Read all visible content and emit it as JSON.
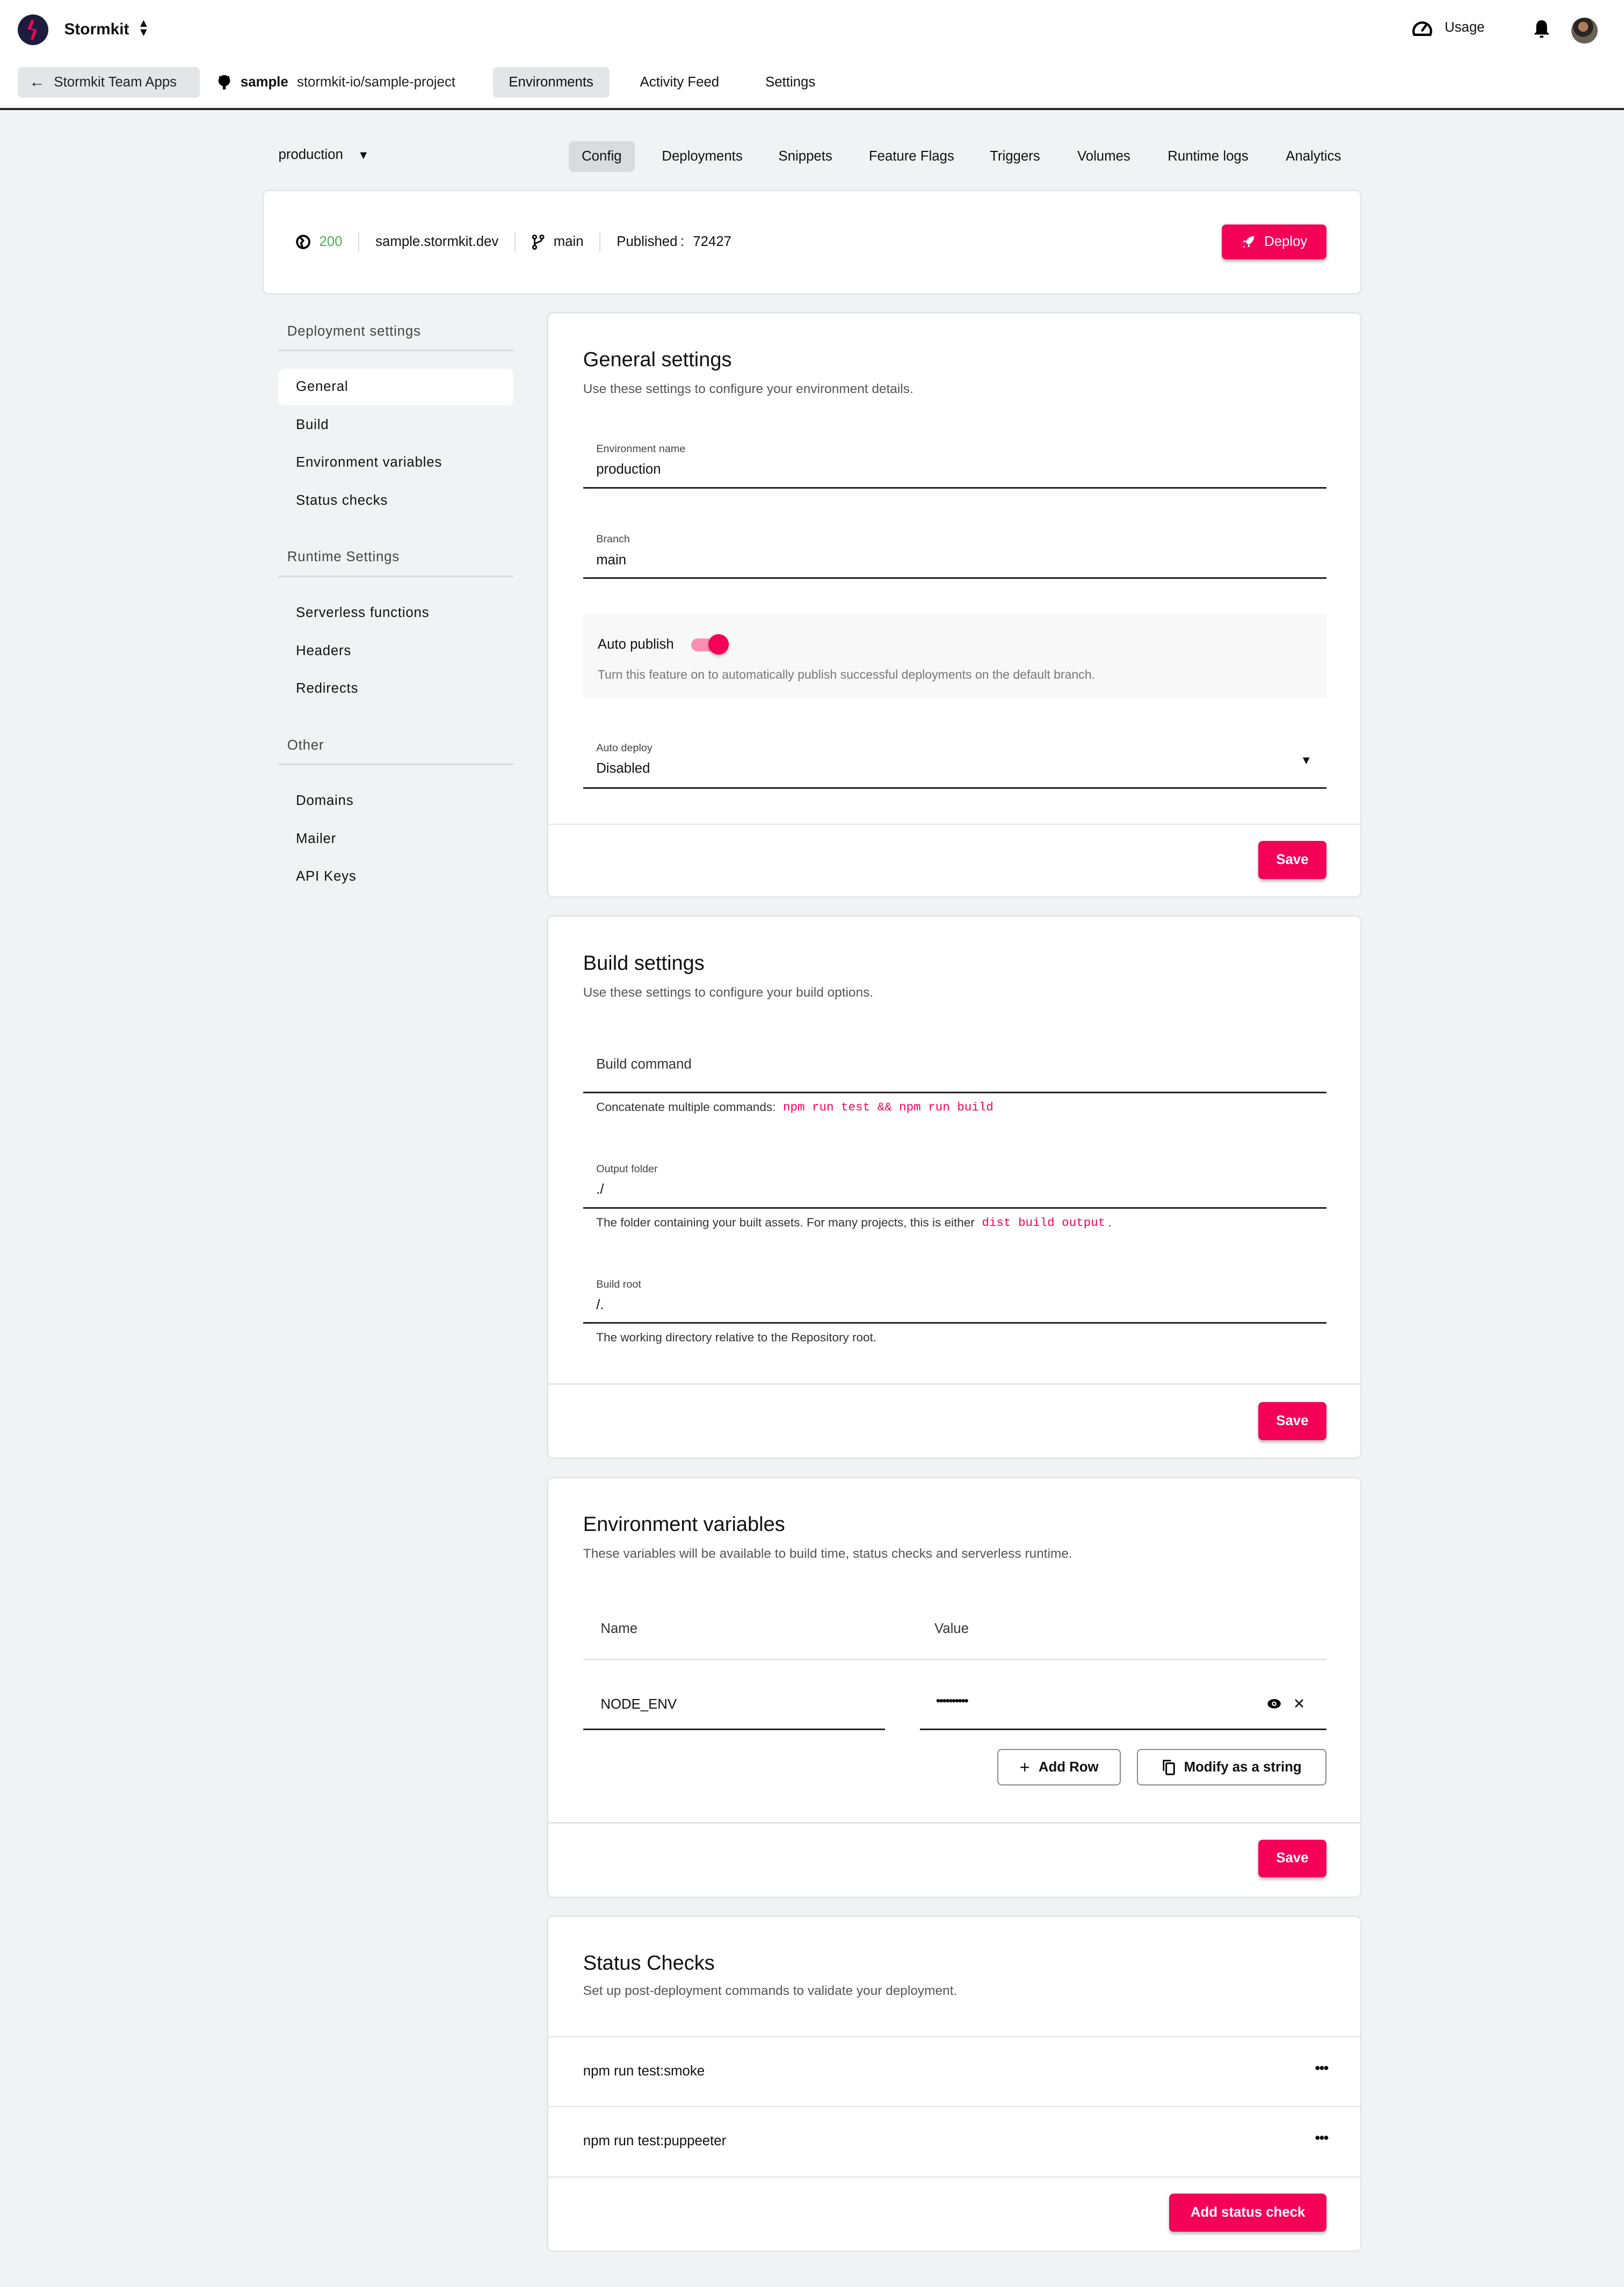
{
  "app": {
    "brand": "Stormkit",
    "usage_label": "Usage",
    "colors": {
      "accent": "#f50057",
      "ok": "#4caf50",
      "logo_bg": "#1e1c3c"
    }
  },
  "nav": {
    "back_label": "Stormkit Team Apps",
    "app_name": "sample",
    "repo": "stormkit-io/sample-project",
    "tabs": [
      {
        "label": "Environments",
        "active": true
      },
      {
        "label": "Activity Feed",
        "active": false
      },
      {
        "label": "Settings",
        "active": false
      }
    ]
  },
  "env": {
    "selected": "production",
    "subtabs": [
      {
        "label": "Config",
        "active": true
      },
      {
        "label": "Deployments"
      },
      {
        "label": "Snippets"
      },
      {
        "label": "Feature Flags"
      },
      {
        "label": "Triggers"
      },
      {
        "label": "Volumes"
      },
      {
        "label": "Runtime logs"
      },
      {
        "label": "Analytics"
      }
    ],
    "status_code": "200",
    "domain": "sample.stormkit.dev",
    "branch": "main",
    "published_label": "Published",
    "published_id": "72427",
    "deploy_label": "Deploy"
  },
  "sidebar": {
    "groups": [
      {
        "title": "Deployment settings",
        "items": [
          "General",
          "Build",
          "Environment variables",
          "Status checks"
        ]
      },
      {
        "title": "Runtime Settings",
        "items": [
          "Serverless functions",
          "Headers",
          "Redirects"
        ]
      },
      {
        "title": "Other",
        "items": [
          "Domains",
          "Mailer",
          "API Keys"
        ]
      }
    ],
    "active_item": "General"
  },
  "general": {
    "title": "General settings",
    "description": "Use these settings to configure your environment details.",
    "env_name_label": "Environment name",
    "env_name_value": "production",
    "branch_label": "Branch",
    "branch_value": "main",
    "auto_publish_label": "Auto publish",
    "auto_publish_on": true,
    "auto_publish_desc": "Turn this feature on to automatically publish successful deployments on the default branch.",
    "auto_deploy_label": "Auto deploy",
    "auto_deploy_value": "Disabled",
    "save_label": "Save"
  },
  "build": {
    "title": "Build settings",
    "description": "Use these settings to configure your build options.",
    "build_command_placeholder": "Build command",
    "build_command_help": "Concatenate multiple commands:",
    "build_command_example": "npm run test && npm run build",
    "output_folder_label": "Output folder",
    "output_folder_value": "./",
    "output_folder_help": "The folder containing your built assets. For many projects, this is either",
    "output_folder_examples": [
      "dist",
      "build",
      "output"
    ],
    "output_folder_help_end": ".",
    "build_root_label": "Build root",
    "build_root_value": "/.",
    "build_root_help": "The working directory relative to the Repository root.",
    "save_label": "Save"
  },
  "envvars": {
    "title": "Environment variables",
    "description": "These variables will be available to build time, status checks and serverless runtime.",
    "col_name": "Name",
    "col_value": "Value",
    "rows": [
      {
        "name": "NODE_ENV",
        "value": "••••••••••"
      }
    ],
    "add_row_label": "Add Row",
    "modify_label": "Modify as a string",
    "save_label": "Save"
  },
  "checks": {
    "title": "Status Checks",
    "description": "Set up post-deployment commands to validate your deployment.",
    "items": [
      "npm run test:smoke",
      "npm run test:puppeeter"
    ],
    "more_label": "•••",
    "add_label": "Add status check"
  }
}
